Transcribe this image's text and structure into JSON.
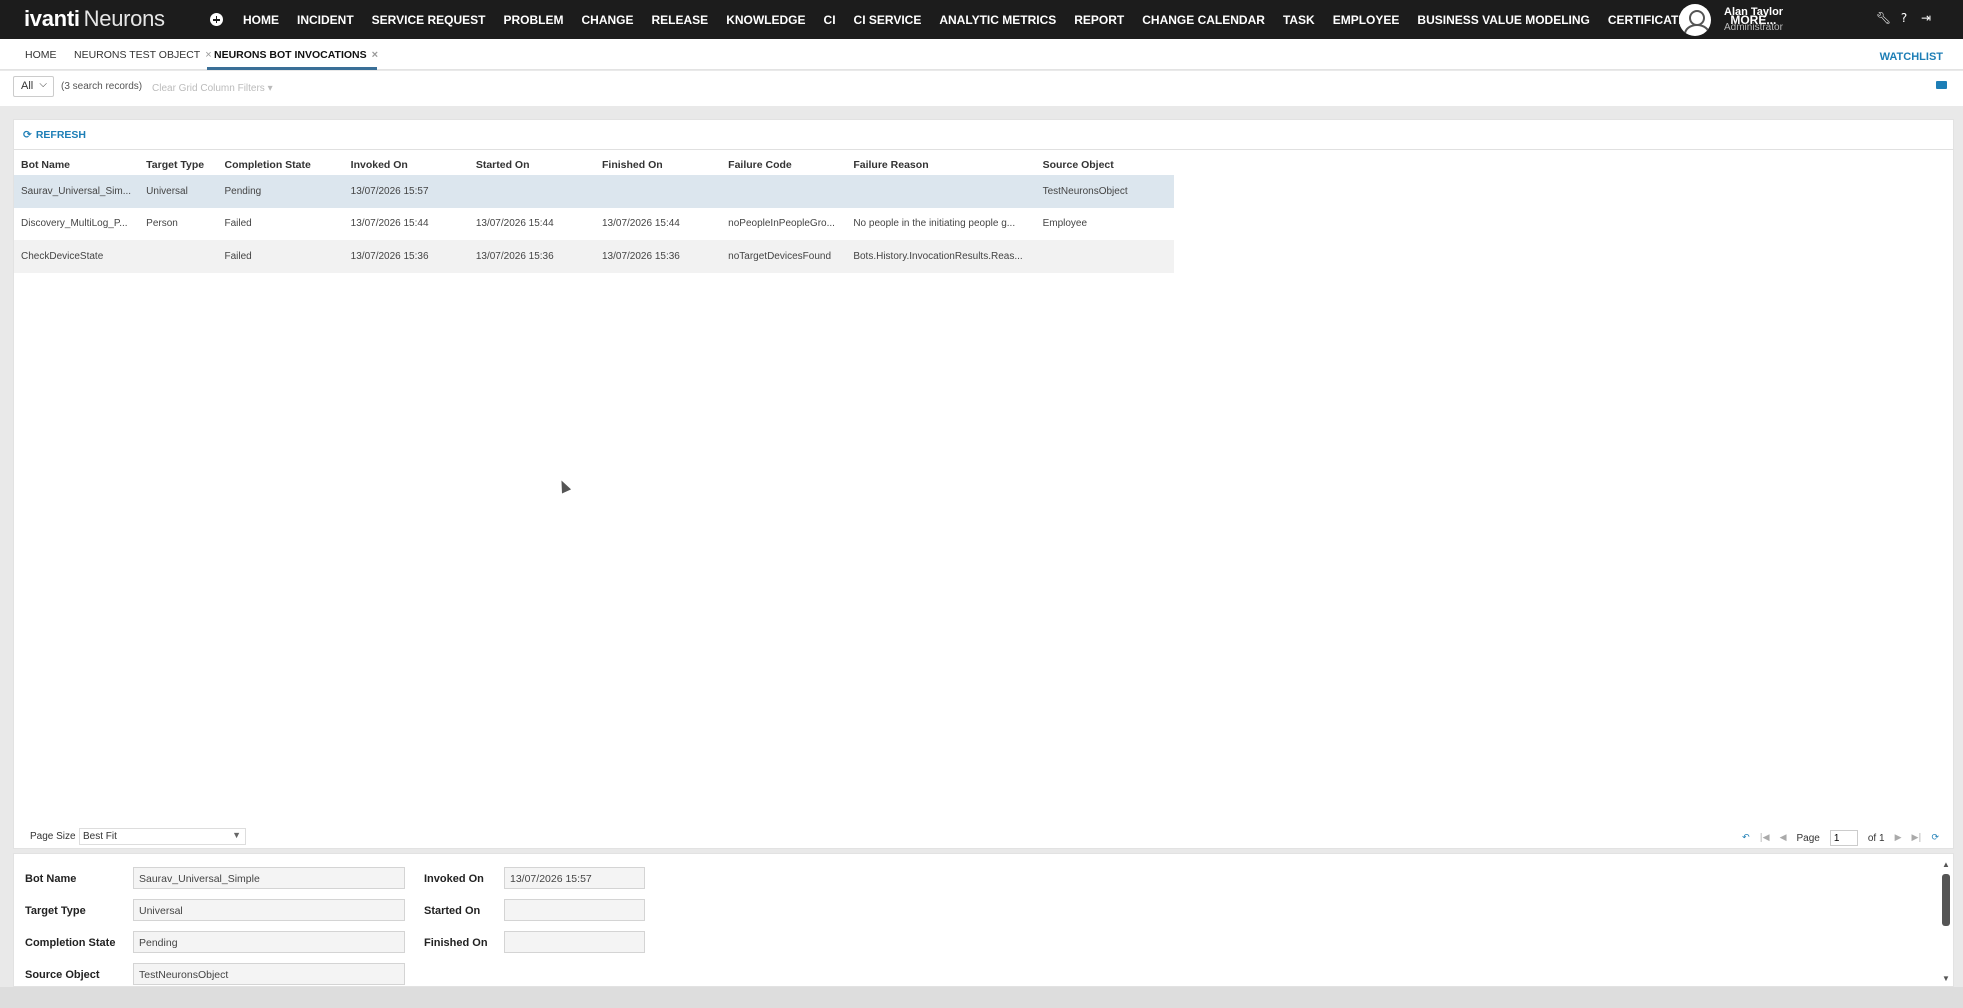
{
  "app": {
    "logo_brand": "ivanti",
    "logo_product": "Neurons"
  },
  "nav": [
    "HOME",
    "INCIDENT",
    "SERVICE REQUEST",
    "PROBLEM",
    "CHANGE",
    "RELEASE",
    "KNOWLEDGE",
    "CI",
    "CI SERVICE",
    "ANALYTIC METRICS",
    "REPORT",
    "CHANGE CALENDAR",
    "TASK",
    "EMPLOYEE",
    "BUSINESS VALUE MODELING",
    "CERTIFICATE",
    "MORE..."
  ],
  "user": {
    "name": "Alan Taylor",
    "role": "Administrator"
  },
  "tabs": [
    {
      "label": "HOME"
    },
    {
      "label": "NEURONS TEST OBJECT",
      "close": "×"
    },
    {
      "label": "NEURONS BOT INVOCATIONS",
      "close": "×"
    }
  ],
  "watchlist_label": "WATCHLIST",
  "filter": {
    "scope": "All",
    "count_text": "(3 search records)",
    "clear_filters": "Clear Grid Column Filters"
  },
  "refresh_label": "REFRESH",
  "grid": {
    "columns": [
      "Bot Name",
      "Target Type",
      "Completion State",
      "Invoked On",
      "Started On",
      "Finished On",
      "Failure Code",
      "Failure Reason",
      "Source Object"
    ],
    "rows": [
      [
        "Saurav_Universal_Sim...",
        "Universal",
        "Pending",
        "13/07/2026 15:57",
        "",
        "",
        "",
        "",
        "TestNeuronsObject"
      ],
      [
        "Discovery_MultiLog_P...",
        "Person",
        "Failed",
        "13/07/2026 15:44",
        "13/07/2026 15:44",
        "13/07/2026 15:44",
        "noPeopleInPeopleGro...",
        "No people in the initiating people g...",
        "Employee"
      ],
      [
        "CheckDeviceState",
        "",
        "Failed",
        "13/07/2026 15:36",
        "13/07/2026 15:36",
        "13/07/2026 15:36",
        "noTargetDevicesFound",
        "Bots.History.InvocationResults.Reas...",
        ""
      ]
    ]
  },
  "pager": {
    "page_size_label": "Page Size",
    "page_size_value": "Best Fit",
    "page_label": "Page",
    "page_value": "1",
    "of_label": "of 1"
  },
  "detail": {
    "bot_name_label": "Bot Name",
    "bot_name": "Saurav_Universal_Simple",
    "target_type_label": "Target Type",
    "target_type": "Universal",
    "completion_state_label": "Completion State",
    "completion_state": "Pending",
    "source_object_label": "Source Object",
    "source_object": "TestNeuronsObject",
    "invoked_on_label": "Invoked On",
    "invoked_on": "13/07/2026 15:57",
    "started_on_label": "Started On",
    "started_on": "",
    "finished_on_label": "Finished On",
    "finished_on": ""
  },
  "colors": {
    "topbar": "#1c1c1c",
    "accent": "#1d7eb6",
    "selected_row": "#dce6ee"
  }
}
